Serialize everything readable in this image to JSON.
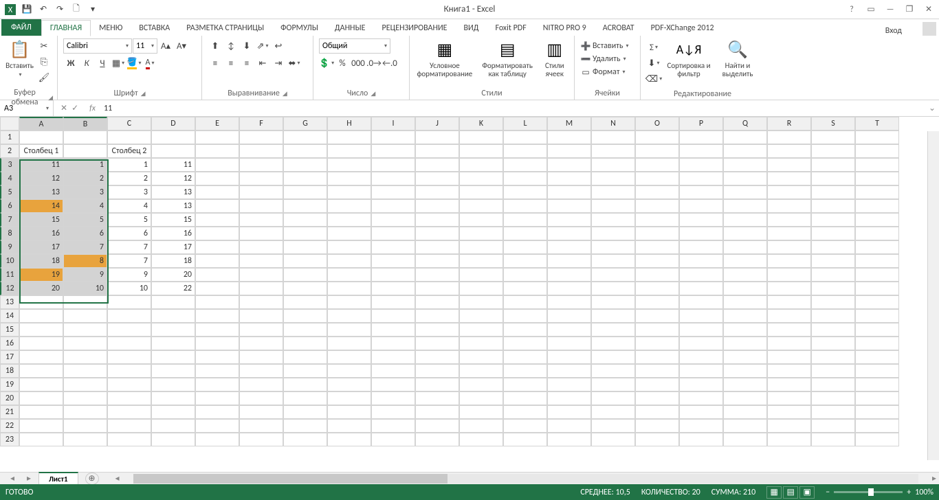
{
  "title": "Книга1 - Excel",
  "qat": {
    "save": "💾",
    "undo": "↶",
    "redo": "↷",
    "new": "🗋"
  },
  "win": {
    "help": "?",
    "opts": "▭",
    "min": "—",
    "max": "❐",
    "close": "✕"
  },
  "login": "Вход",
  "tabs": {
    "file": "ФАЙЛ",
    "home": "ГЛАВНАЯ",
    "menu": "Меню",
    "insert": "ВСТАВКА",
    "layout": "РАЗМЕТКА СТРАНИЦЫ",
    "formulas": "ФОРМУЛЫ",
    "data": "ДАННЫЕ",
    "review": "РЕЦЕНЗИРОВАНИЕ",
    "view": "ВИД",
    "foxit": "Foxit PDF",
    "nitro": "NITRO PRO 9",
    "acrobat": "ACROBAT",
    "pdfx": "PDF-XChange 2012"
  },
  "ribbon": {
    "clipboard": {
      "paste": "Вставить",
      "label": "Буфер обмена"
    },
    "font": {
      "name": "Calibri",
      "size": "11",
      "label": "Шрифт",
      "bold": "Ж",
      "italic": "К",
      "underline": "Ч"
    },
    "align": {
      "label": "Выравнивание"
    },
    "number": {
      "format": "Общий",
      "label": "Число"
    },
    "styles": {
      "cond": "Условное форматирование",
      "table": "Форматировать как таблицу",
      "cell": "Стили ячеек",
      "label": "Стили"
    },
    "cells": {
      "insert": "Вставить",
      "delete": "Удалить",
      "format": "Формат",
      "label": "Ячейки"
    },
    "editing": {
      "sort": "Сортировка и фильтр",
      "find": "Найти и выделить",
      "label": "Редактирование"
    }
  },
  "nameBox": "A3",
  "formula": "11",
  "cols": [
    "A",
    "B",
    "C",
    "D",
    "E",
    "F",
    "G",
    "H",
    "I",
    "J",
    "K",
    "L",
    "M",
    "N",
    "O",
    "P",
    "Q",
    "R",
    "S",
    "T"
  ],
  "rows": [
    1,
    2,
    3,
    4,
    5,
    6,
    7,
    8,
    9,
    10,
    11,
    12,
    13,
    14,
    15,
    16,
    17,
    18,
    19,
    20,
    21,
    22,
    23
  ],
  "headers": {
    "c1": "Столбец 1",
    "c2": "Столбец 2"
  },
  "colA": [
    11,
    12,
    13,
    14,
    15,
    16,
    17,
    18,
    19,
    20
  ],
  "colB": [
    1,
    2,
    3,
    4,
    5,
    6,
    7,
    8,
    9,
    10
  ],
  "colC": [
    1,
    2,
    3,
    4,
    5,
    6,
    7,
    7,
    9,
    10
  ],
  "colD": [
    11,
    12,
    13,
    13,
    15,
    16,
    17,
    18,
    20,
    22
  ],
  "hlA": [
    14,
    19
  ],
  "hlB": [
    8
  ],
  "sheetTab": "Лист1",
  "status": {
    "ready": "ГОТОВО",
    "avg": "СРЕДНЕЕ: 10,5",
    "count": "КОЛИЧЕСТВО: 20",
    "sum": "СУММА: 210",
    "zoom": "100%"
  }
}
